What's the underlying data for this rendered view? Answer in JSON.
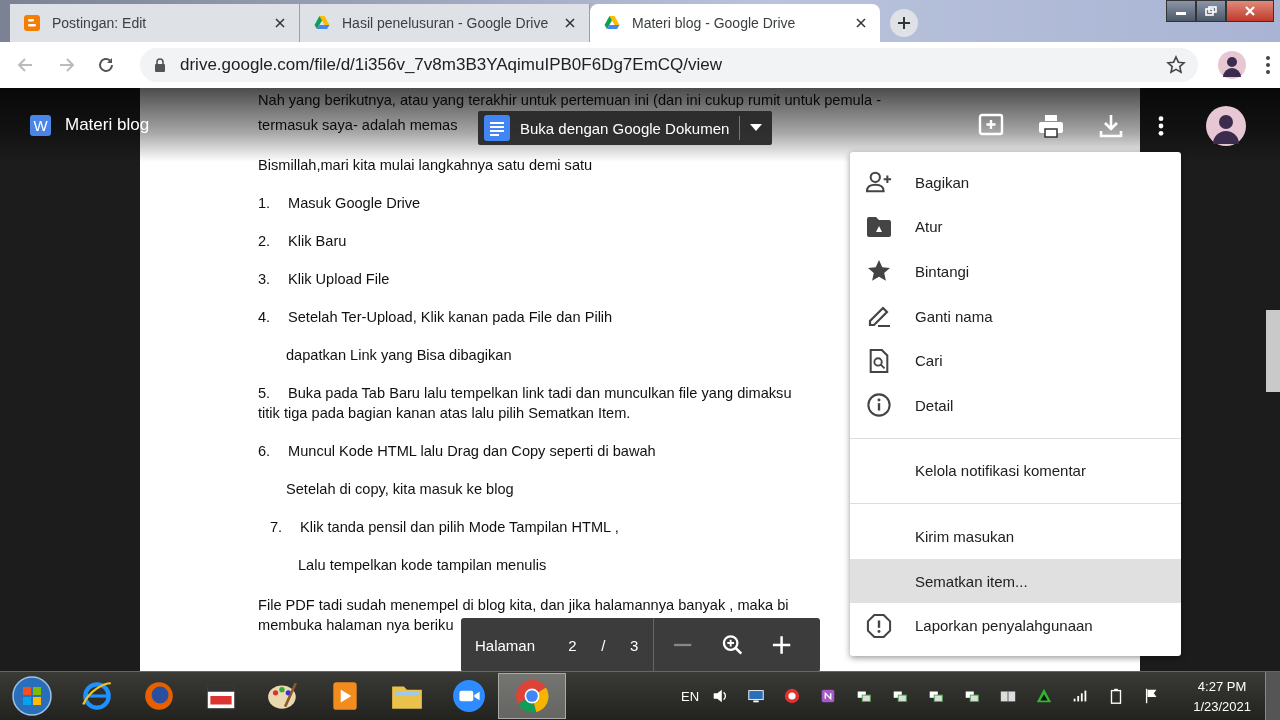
{
  "browser": {
    "tabs": [
      {
        "title": "Postingan: Edit",
        "selected": false,
        "kind": "blogger"
      },
      {
        "title": "Hasil penelusuran - Google Drive",
        "selected": false,
        "kind": "drive"
      },
      {
        "title": "Materi blog - Google Drive",
        "selected": true,
        "kind": "drive"
      }
    ],
    "url": "drive.google.com/file/d/1i356v_7v8m3B3YAqimuIPB0F6Dg7EmCQ/view"
  },
  "viewer": {
    "file_badge": "W",
    "title": "Materi blog",
    "open_with": "Buka dengan Google Dokumen",
    "document": [
      {
        "kind": "plain",
        "text": "Nah yang berikutnya, atau yang terakhir untuk pertemuan ini (dan ini cukup rumit untuk pemula -"
      },
      {
        "kind": "plain",
        "text": "termasuk saya- adalah memas"
      },
      {
        "kind": "gap-plain",
        "text": "Bismillah,mari kita mulai langkahnya satu demi satu"
      },
      {
        "kind": "numbered",
        "number": "1.",
        "text": "Masuk Google Drive"
      },
      {
        "kind": "numbered",
        "number": "2.",
        "text": "Klik Baru"
      },
      {
        "kind": "numbered",
        "number": "3.",
        "text": "Klik Upload File"
      },
      {
        "kind": "numbered",
        "number": "4.",
        "text": "Setelah Ter-Upload, Klik kanan pada File dan Pilih"
      },
      {
        "kind": "sub",
        "text": "dapatkan Link yang Bisa dibagikan"
      },
      {
        "kind": "numbered",
        "number": "5.",
        "text": "Buka pada Tab Baru lalu tempelkan link tadi dan munculkan file yang dimaksu"
      },
      {
        "kind": "plain",
        "text": "titik tiga pada bagian kanan atas lalu pilih Sematkan Item."
      },
      {
        "kind": "numbered",
        "number": "6.",
        "text": "Muncul Kode HTML lalu Drag dan Copy seperti di bawah"
      },
      {
        "kind": "sub",
        "text": "Setelah di copy, kita masuk ke blog"
      },
      {
        "kind": "numbered-inset",
        "number": "7.",
        "text": "Klik tanda pensil  dan pilih Mode  Tampilan HTML ,"
      },
      {
        "kind": "sub-inset",
        "text": "Lalu tempelkan kode tampilan menulis"
      },
      {
        "kind": "gap-plain",
        "text": "File PDF tadi sudah menempel di blog kita, dan jika halamannya banyak , maka bi"
      },
      {
        "kind": "plain",
        "text": "membuka halaman nya beriku"
      }
    ],
    "menu": [
      {
        "kind": "item",
        "label": "Bagikan",
        "selected": false
      },
      {
        "kind": "item",
        "label": "Atur",
        "selected": false
      },
      {
        "kind": "item",
        "label": "Bintangi",
        "selected": false
      },
      {
        "kind": "item",
        "label": "Ganti nama",
        "selected": false
      },
      {
        "kind": "item",
        "label": "Cari",
        "selected": false
      },
      {
        "kind": "item",
        "label": "Detail",
        "selected": false
      },
      {
        "kind": "divider"
      },
      {
        "kind": "item",
        "label": "Kelola notifikasi komentar",
        "selected": false
      },
      {
        "kind": "divider"
      },
      {
        "kind": "item",
        "label": "Kirim masukan",
        "selected": false
      },
      {
        "kind": "item",
        "label": "Sematkan item...",
        "selected": true
      },
      {
        "kind": "item",
        "label": "Laporkan penyalahgunaan",
        "selected": false
      }
    ],
    "pager": {
      "label": "Halaman",
      "current": "2",
      "separator": "/",
      "total": "3"
    }
  },
  "taskbar": {
    "language": "EN",
    "time": "4:27 PM",
    "date": "1/23/2021"
  }
}
